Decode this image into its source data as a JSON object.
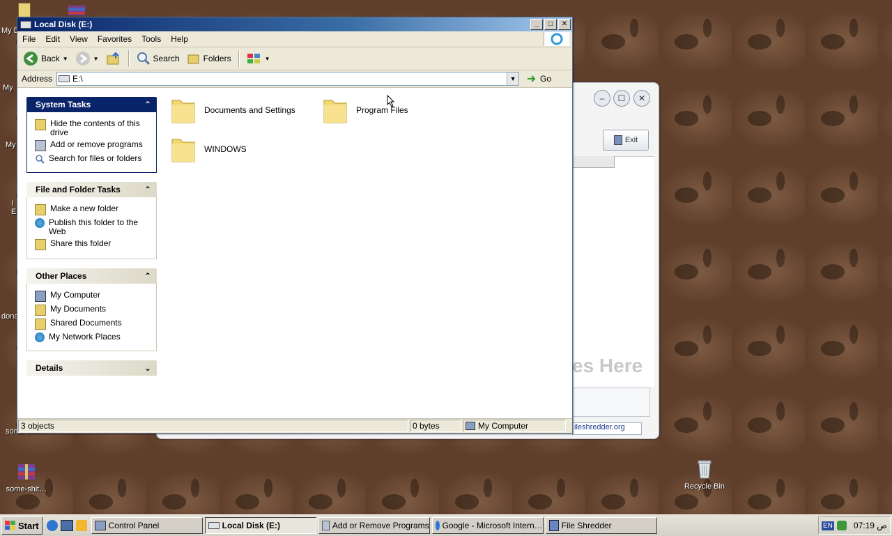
{
  "desktop": {
    "icons": [
      {
        "label": "some-shit…",
        "icon": "winrar-archive-icon"
      },
      {
        "label": "Recycle Bin",
        "icon": "recycle-bin-icon"
      }
    ],
    "partial_labels": [
      "My D",
      "My",
      "My",
      "I",
      "E",
      "dona",
      "some-shit…"
    ]
  },
  "background_app": {
    "exit_label": "Exit",
    "drop_hint": "es Here",
    "link_text": "ileshredder.org"
  },
  "window": {
    "title": "Local Disk (E:)",
    "menu": [
      "File",
      "Edit",
      "View",
      "Favorites",
      "Tools",
      "Help"
    ],
    "toolbar": {
      "back": "Back",
      "search": "Search",
      "folders": "Folders"
    },
    "address": {
      "label": "Address",
      "value": "E:\\",
      "go": "Go"
    },
    "task_panes": {
      "system": {
        "title": "System Tasks",
        "items": [
          "Hide the contents of this drive",
          "Add or remove programs",
          "Search for files or folders"
        ]
      },
      "file_folder": {
        "title": "File and Folder Tasks",
        "items": [
          "Make a new folder",
          "Publish this folder to the Web",
          "Share this folder"
        ]
      },
      "other": {
        "title": "Other Places",
        "items": [
          "My Computer",
          "My Documents",
          "Shared Documents",
          "My Network Places"
        ]
      },
      "details": {
        "title": "Details"
      }
    },
    "folders": [
      "Documents and Settings",
      "Program Files",
      "WINDOWS"
    ],
    "status": {
      "objects": "3 objects",
      "size": "0 bytes",
      "location": "My Computer"
    }
  },
  "taskbar": {
    "start": "Start",
    "buttons": [
      "Control Panel",
      "Local Disk (E:)",
      "Add or Remove Programs",
      "Google - Microsoft Intern…",
      "File Shredder"
    ],
    "tray": {
      "lang": "EN",
      "time": "07:19 ص"
    }
  }
}
